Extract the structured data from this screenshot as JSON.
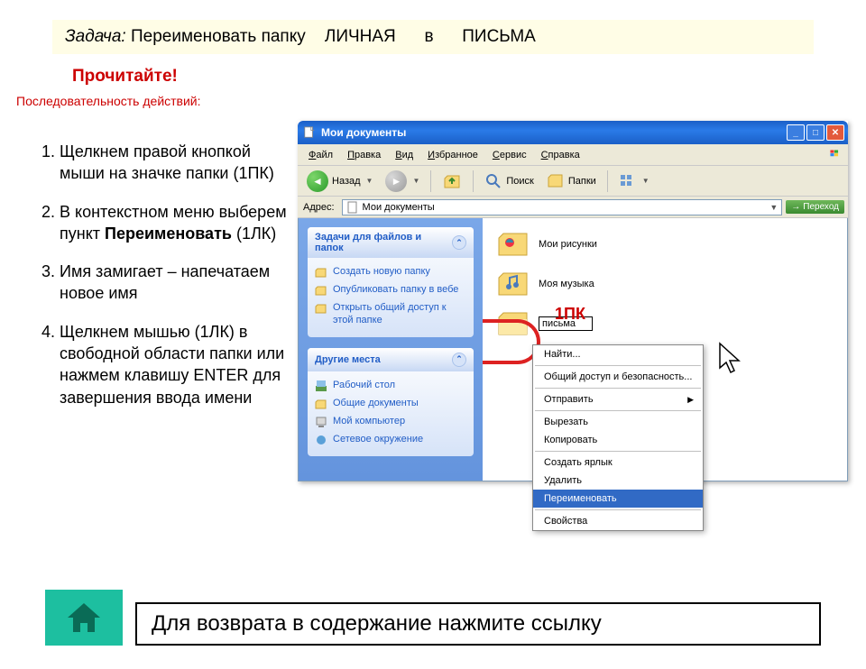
{
  "task": {
    "label": "Задача:",
    "text_before": "Переименовать папку",
    "folder_from": "ЛИЧНАЯ",
    "mid": "в",
    "folder_to": "ПИСЬМА"
  },
  "read_it": "Прочитайте!",
  "sequence_label": "Последовательность действий:",
  "steps": [
    "Щелкнем правой кнопкой мыши на значке папки (1ПК)",
    "В контекстном меню выберем пункт <b>Переименовать</b> (1ЛК)",
    "Имя замигает – напечатаем  новое имя",
    "Щелкнем мышью (1ЛК) в свободной области папки или нажмем клавишу ENTER для завершения ввода имени"
  ],
  "window": {
    "title": "Мои документы",
    "menu": [
      "Файл",
      "Правка",
      "Вид",
      "Избранное",
      "Сервис",
      "Справка"
    ],
    "toolbar": {
      "back": "Назад",
      "search": "Поиск",
      "folders": "Папки"
    },
    "address": {
      "label": "Адрес:",
      "value": "Мои документы",
      "go": "Переход"
    },
    "side_panels": {
      "tasks": {
        "title": "Задачи для файлов и папок",
        "items": [
          "Создать новую папку",
          "Опубликовать папку в вебе",
          "Открыть общий доступ к этой папке"
        ]
      },
      "places": {
        "title": "Другие места",
        "items": [
          "Рабочий стол",
          "Общие документы",
          "Мой компьютер",
          "Сетевое окружение"
        ]
      }
    },
    "folders": [
      {
        "name": "Мои рисунки",
        "type": "pictures"
      },
      {
        "name": "Моя музыка",
        "type": "music"
      },
      {
        "name": "письма",
        "type": "plain",
        "editing": true
      }
    ],
    "ctx_menu": [
      {
        "label": "Найти...",
        "sep_after": true
      },
      {
        "label": "Общий доступ и безопасность...",
        "sep_after": true
      },
      {
        "label": "Отправить",
        "submenu": true,
        "sep_after": true
      },
      {
        "label": "Вырезать"
      },
      {
        "label": "Копировать",
        "sep_after": true
      },
      {
        "label": "Создать ярлык"
      },
      {
        "label": "Удалить"
      },
      {
        "label": "Переименовать",
        "selected": true,
        "sep_after": true
      },
      {
        "label": "Свойства"
      }
    ]
  },
  "annotation_1pk": "1ПК",
  "return_text": "Для возврата в содержание нажмите ссылку"
}
